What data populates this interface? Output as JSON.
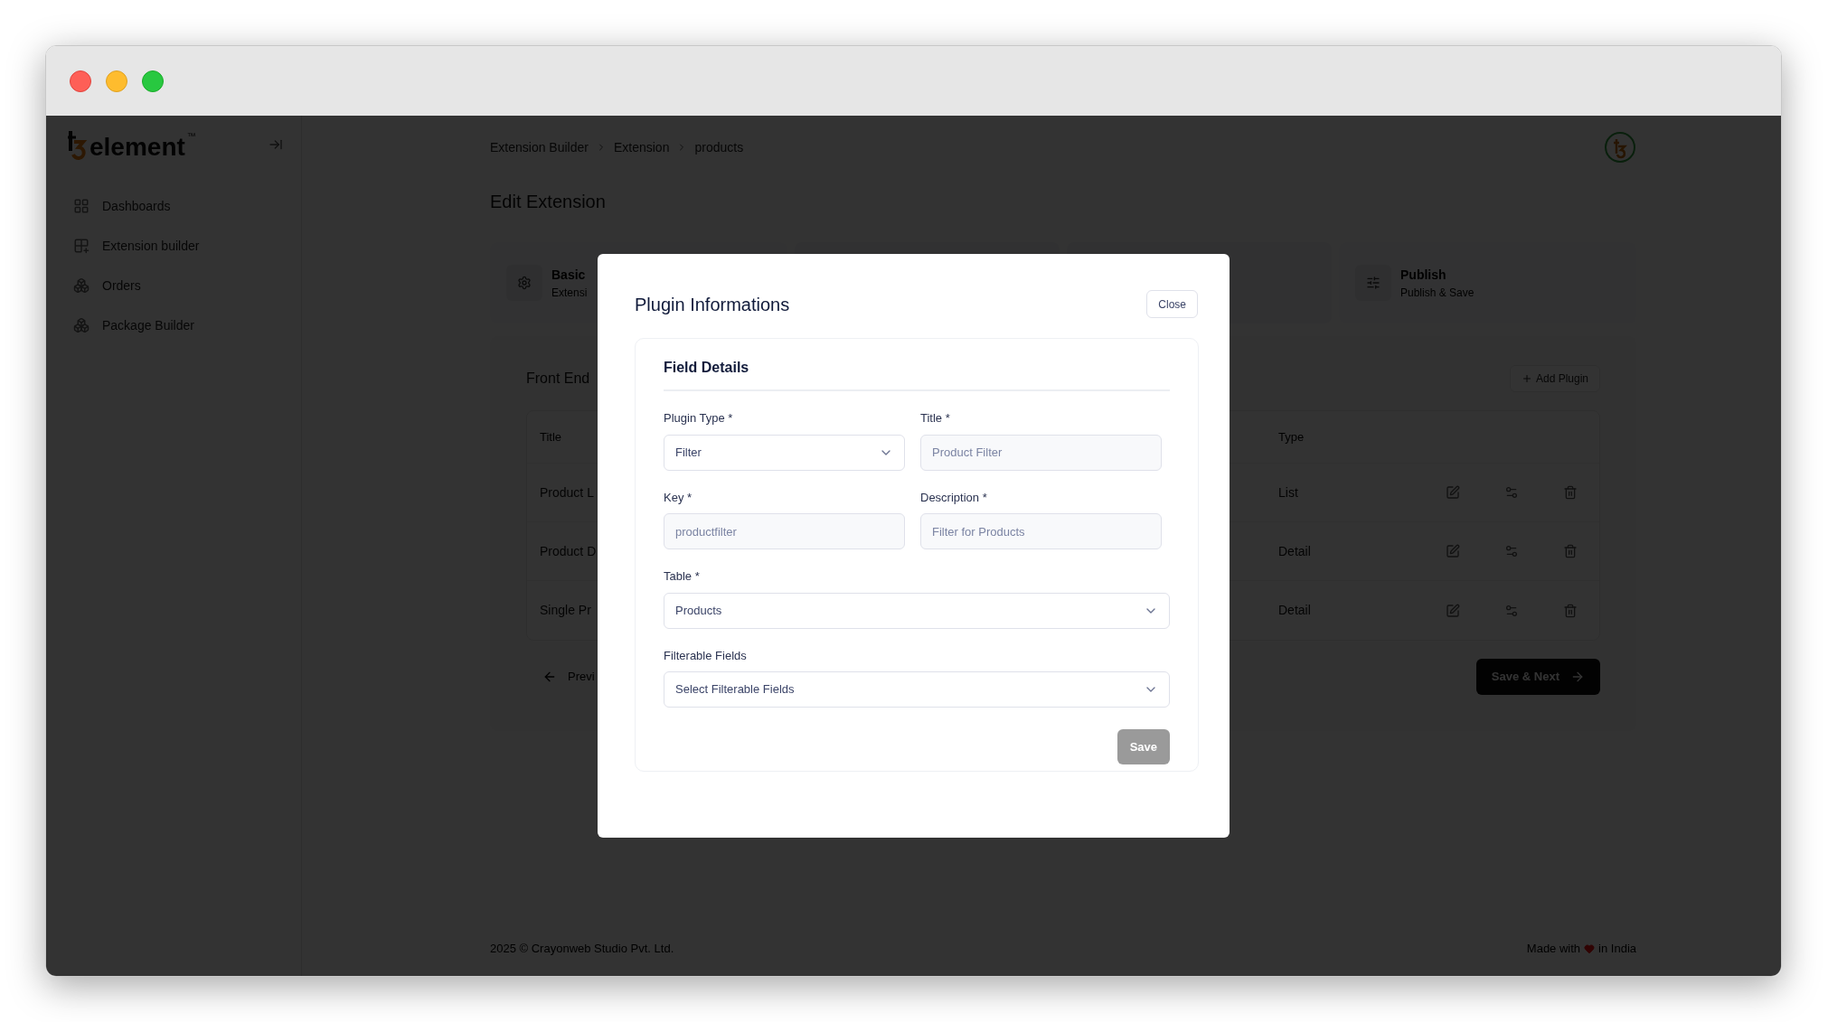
{
  "logo": {
    "text": "element",
    "mark": "™"
  },
  "sidebar": {
    "items": [
      {
        "label": "Dashboards"
      },
      {
        "label": "Extension builder"
      },
      {
        "label": "Orders"
      },
      {
        "label": "Package Builder"
      }
    ]
  },
  "breadcrumb": [
    "Extension Builder",
    "Extension",
    "products"
  ],
  "page_title": "Edit Extension",
  "steps": [
    {
      "title": "Basic",
      "subtitle": "Extensi"
    },
    {
      "title": "Publish",
      "subtitle": "Publish & Save"
    }
  ],
  "section": {
    "title": "Front End",
    "add_button": "Add Plugin"
  },
  "table": {
    "columns": [
      "Title",
      "Type"
    ],
    "rows": [
      {
        "title": "Product L",
        "type": "List"
      },
      {
        "title": "Product D",
        "type": "Detail"
      },
      {
        "title": "Single Pr",
        "type": "Detail"
      }
    ]
  },
  "prev_button": "Previ",
  "next_button": "Save & Next",
  "footer": {
    "copyright": "2025 ©  Crayonweb Studio Pvt. Ltd.",
    "made_with": "Made with",
    "in_india": "in India"
  },
  "modal": {
    "title": "Plugin Informations",
    "close_button": "Close",
    "card_title": "Field Details",
    "fields": [
      {
        "kind": "select",
        "label": "Plugin Type *",
        "value": "Filter",
        "disabled": false,
        "wide": false
      },
      {
        "kind": "input",
        "label": "Title *",
        "value": "Product Filter",
        "disabled": true,
        "wide": false
      },
      {
        "kind": "input",
        "label": "Key *",
        "value": "productfilter",
        "disabled": true,
        "wide": false
      },
      {
        "kind": "input",
        "label": "Description *",
        "value": "Filter for Products",
        "disabled": true,
        "wide": false
      },
      {
        "kind": "select",
        "label": "Table *",
        "value": "Products",
        "disabled": false,
        "wide": true
      },
      {
        "kind": "select",
        "label": "Filterable Fields",
        "placeholder": "Select Filterable Fields",
        "disabled": false,
        "wide": true
      }
    ],
    "save_button": {
      "label": "Save",
      "disabled": true
    }
  }
}
